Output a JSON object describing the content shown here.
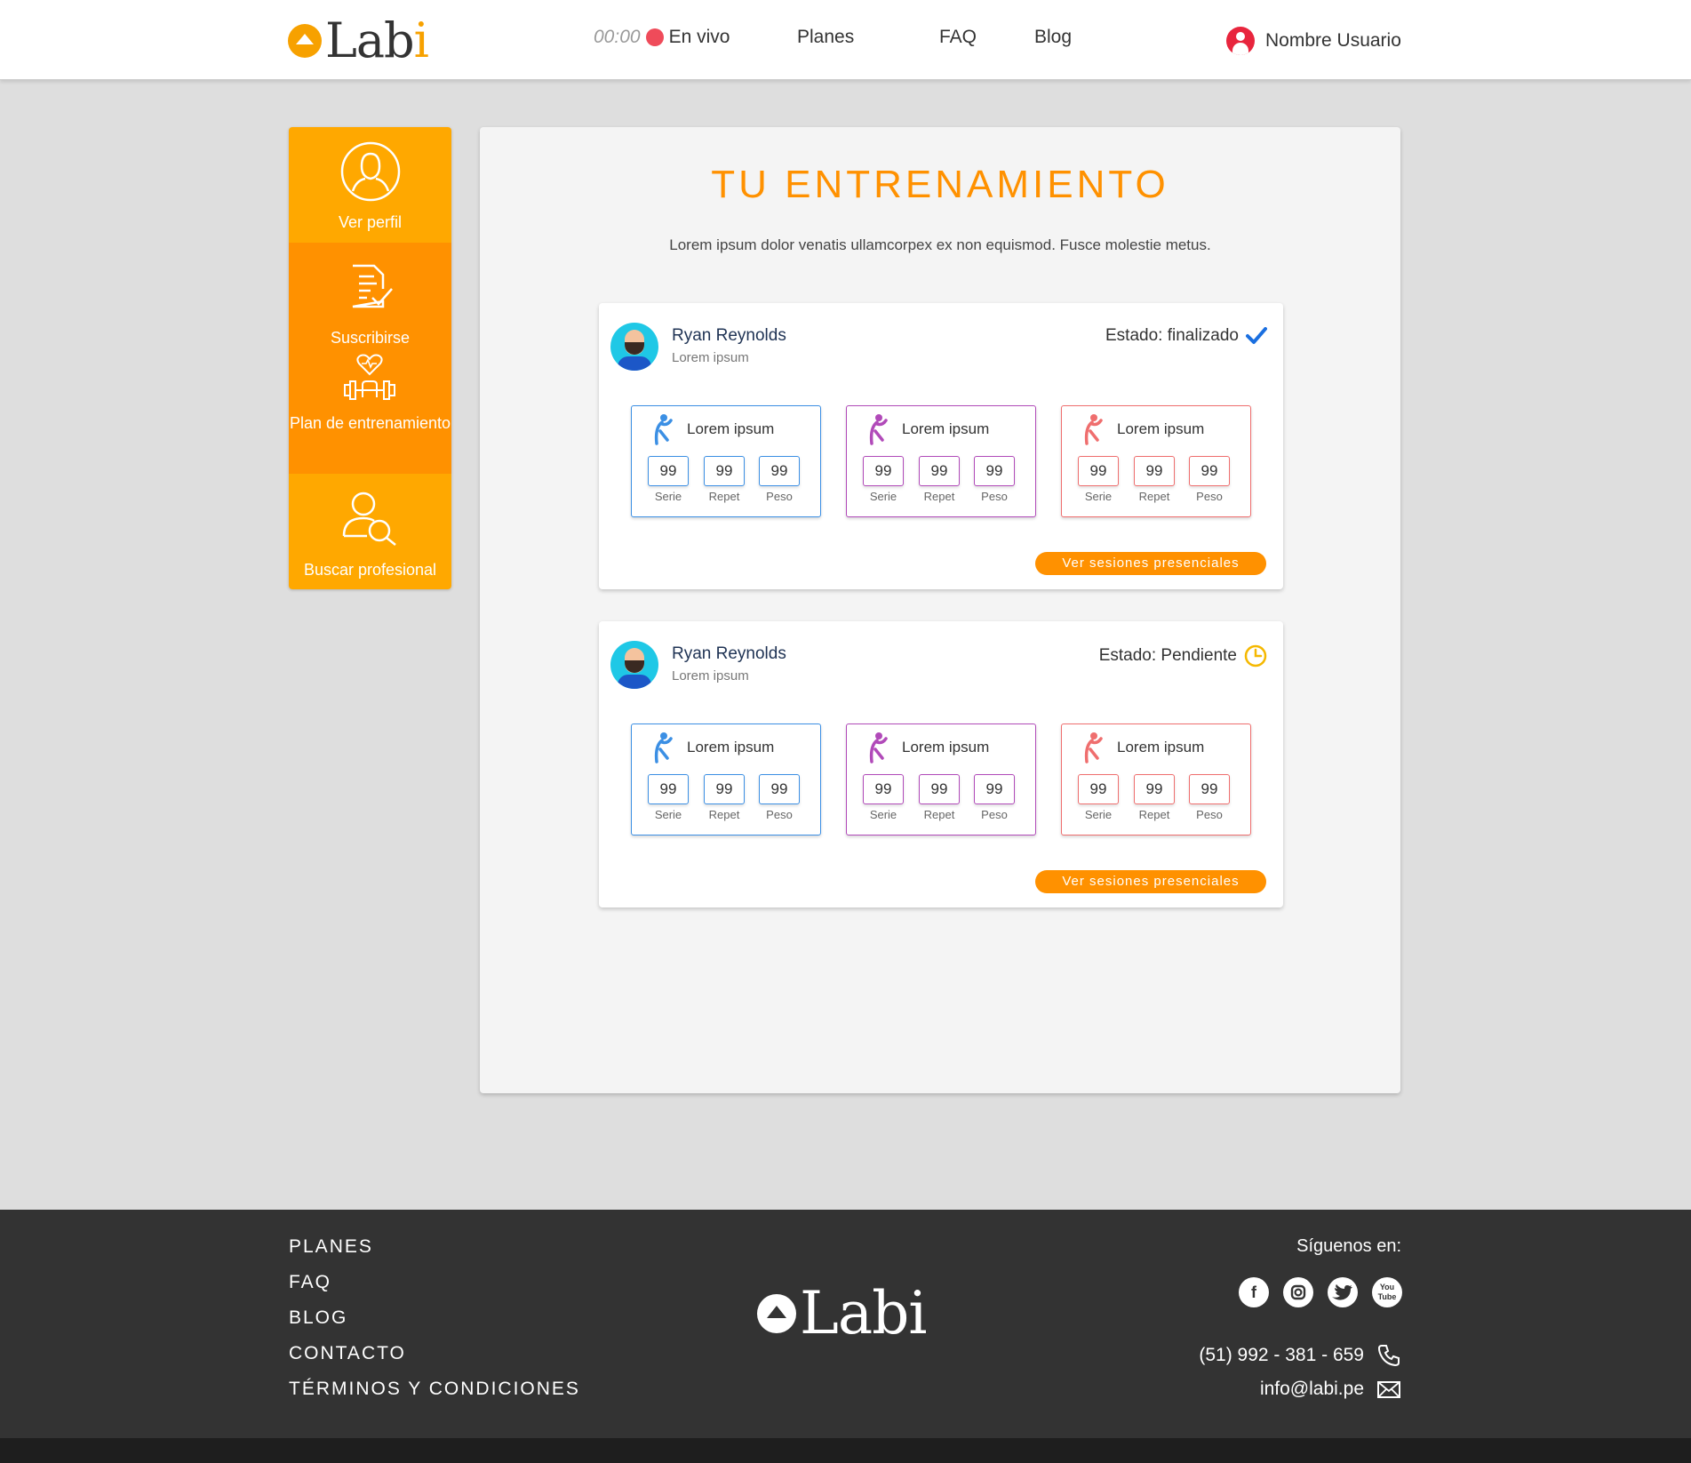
{
  "header": {
    "logo_text": "Labi",
    "timer": "00:00",
    "live_label": "En vivo",
    "nav": [
      "Planes",
      "FAQ",
      "Blog"
    ],
    "user_name": "Nombre Usuario"
  },
  "sidebar": {
    "items": [
      {
        "label": "Ver perfil",
        "icon": "user-circle-icon"
      },
      {
        "label": "Suscribirse",
        "icon": "document-check-icon"
      },
      {
        "label": "Plan de entrenamiento",
        "icon": "heart-dumbbell-icon"
      },
      {
        "label": "Buscar profesional",
        "icon": "user-search-icon"
      }
    ]
  },
  "main": {
    "title": "TU ENTRENAMIENTO",
    "subtitle": "Lorem ipsum dolor venatis ullamcorpex ex non equismod. Fusce molestie metus.",
    "cards": [
      {
        "name": "Ryan Reynolds",
        "sub": "Lorem ipsum",
        "status": "Estado: finalizado",
        "status_icon": "checkmark-icon",
        "status_color": "#1a6fe0",
        "exercises": [
          {
            "title": "Lorem ipsum",
            "color": "#3b8fe4",
            "serie": "99",
            "repet": "99",
            "peso": "99"
          },
          {
            "title": "Lorem ipsum",
            "color": "#b14ab9",
            "serie": "99",
            "repet": "99",
            "peso": "99"
          },
          {
            "title": "Lorem ipsum",
            "color": "#ef6e6e",
            "serie": "99",
            "repet": "99",
            "peso": "99"
          }
        ],
        "button": "Ver sesiones presenciales"
      },
      {
        "name": "Ryan Reynolds",
        "sub": "Lorem ipsum",
        "status": "Estado: Pendiente",
        "status_icon": "clock-icon",
        "status_color": "#f5b800",
        "exercises": [
          {
            "title": "Lorem ipsum",
            "color": "#3b8fe4",
            "serie": "99",
            "repet": "99",
            "peso": "99"
          },
          {
            "title": "Lorem ipsum",
            "color": "#b14ab9",
            "serie": "99",
            "repet": "99",
            "peso": "99"
          },
          {
            "title": "Lorem ipsum",
            "color": "#ef6e6e",
            "serie": "99",
            "repet": "99",
            "peso": "99"
          }
        ],
        "button": "Ver sesiones presenciales"
      }
    ],
    "stat_labels": {
      "serie": "Serie",
      "repet": "Repet",
      "peso": "Peso"
    }
  },
  "footer": {
    "links": [
      "PLANES",
      "FAQ",
      "BLOG",
      "CONTACTO",
      "TÉRMINOS Y CONDICIONES"
    ],
    "logo_text": "Labi",
    "follow_label": "Síguenos en:",
    "socials": [
      "facebook-icon",
      "instagram-icon",
      "twitter-icon",
      "youtube-icon"
    ],
    "phone": "(51) 992 - 381 - 659",
    "email": "info@labi.pe"
  },
  "colors": {
    "accent": "#ff9100",
    "accent_light": "#ffa800",
    "live_dot": "#ef4b5a",
    "footer_bg": "#333333"
  }
}
